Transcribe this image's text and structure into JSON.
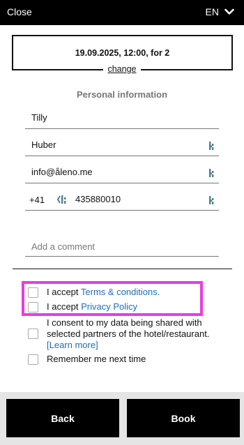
{
  "topbar": {
    "close_label": "Close",
    "language": "EN",
    "language_icon": "chevron-down-icon"
  },
  "summary": {
    "text": "19.09.2025, 12:00, for 2",
    "change_label": "change"
  },
  "section_title": "Personal information",
  "form": {
    "first_name": "Tilly",
    "last_name": "Huber",
    "email": "info@åleno.me",
    "phone_prefix": "+41",
    "phone_number": "435880010",
    "comment_placeholder": "Add a comment",
    "field_icon": "autofill-key-icon"
  },
  "consents": {
    "terms_prefix": "I accept ",
    "terms_link": "Terms & conditions.",
    "privacy_prefix": "I accept ",
    "privacy_link": "Privacy Policy",
    "partners_text": "I consent to my data being shared with selected partners of the hotel/restaurant.",
    "partners_link": "[Learn more]",
    "remember_text": "Remember me next time"
  },
  "colors": {
    "accent_link": "#1f6db7",
    "highlight": "#ea3be5",
    "footer_bg": "#e5e5e5"
  },
  "footer": {
    "back_label": "Back",
    "book_label": "Book"
  }
}
